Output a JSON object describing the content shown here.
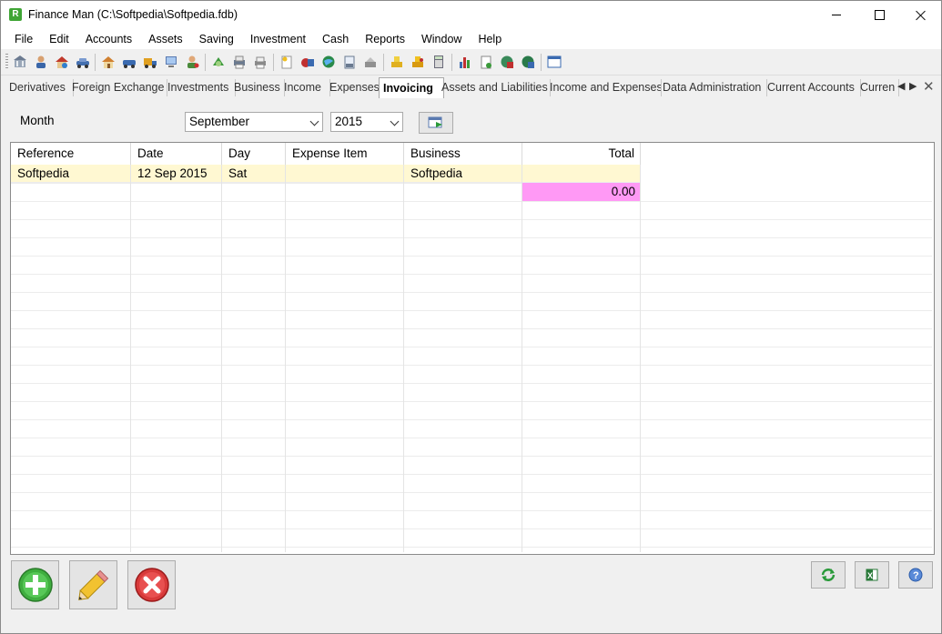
{
  "window": {
    "title": "Finance Man (C:\\Softpedia\\Softpedia.fdb)",
    "app_icon_letter": "R"
  },
  "menu": {
    "items": [
      "File",
      "Edit",
      "Accounts",
      "Assets",
      "Saving",
      "Investment",
      "Cash",
      "Reports",
      "Window",
      "Help"
    ]
  },
  "toolbar": {
    "icons": [
      "bank-icon",
      "person-icon",
      "house-icon",
      "car-icon",
      "home-icon",
      "vehicle-icon",
      "truck-icon",
      "computer-icon",
      "user-icon",
      "money-icon",
      "printer-icon",
      "print-icon",
      "note-icon",
      "piggy-bank-icon",
      "globe-icon",
      "document-icon",
      "cash-register-icon",
      "coins-icon",
      "gold-icon",
      "calculator-icon",
      "bar-chart-icon",
      "new-document-icon",
      "globe-chart-icon",
      "globe-chart-2-icon",
      "window-icon"
    ]
  },
  "tabs": {
    "items": [
      "Derivatives",
      "Foreign Exchange",
      "Investments",
      "Business",
      "Income",
      "Expenses",
      "Invoicing",
      "Assets and Liabilities",
      "Income and Expenses",
      "Data Administration",
      "Current Accounts",
      "Curren"
    ],
    "active": "Invoicing",
    "close_glyph": "✕",
    "prev_glyph": "◀",
    "next_glyph": "▶"
  },
  "filter": {
    "month_label": "Month",
    "month_value": "September",
    "year_value": "2015"
  },
  "grid": {
    "columns": [
      "Reference",
      "Date",
      "Day",
      "Expense Item",
      "Business",
      "Total"
    ],
    "rows": [
      {
        "reference": "Softpedia",
        "date": "12 Sep 2015",
        "day": "Sat",
        "expense_item": "",
        "business": "Softpedia",
        "total": ""
      }
    ],
    "grand_total": "0.00"
  },
  "colors": {
    "selected_row": "#fff8d2",
    "total_highlight": "#ff99f5"
  }
}
